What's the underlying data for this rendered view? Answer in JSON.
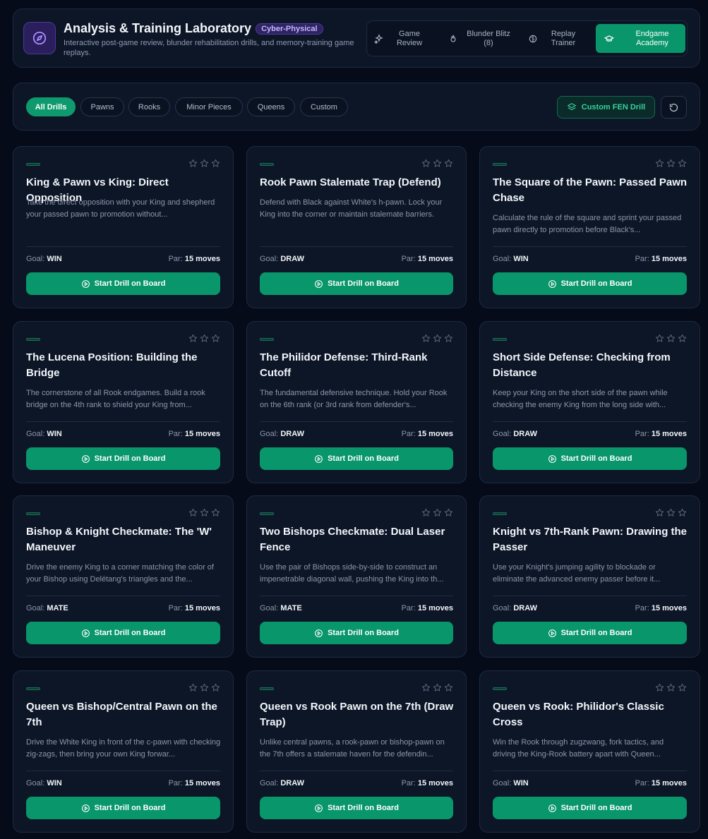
{
  "header": {
    "title": "Analysis & Training Laboratory",
    "badge": "Cyber-Physical",
    "subtitle": "Interactive post-game review, blunder rehabilitation drills, and memory-training game replays."
  },
  "modes": [
    {
      "label": "Game Review",
      "icon": "sparkles-icon",
      "active": false
    },
    {
      "label": "Blunder Blitz (8)",
      "icon": "flame-icon",
      "active": false
    },
    {
      "label": "Replay Trainer",
      "icon": "brain-icon",
      "active": false
    },
    {
      "label": "Endgame Academy",
      "icon": "graduation-cap-icon",
      "active": true
    }
  ],
  "filters": {
    "chips": [
      "All Drills",
      "Pawns",
      "Rooks",
      "Minor Pieces",
      "Queens",
      "Custom"
    ],
    "active": "All Drills",
    "custom_fen_label": "Custom FEN Drill",
    "custom_fen_icon": "layers-icon",
    "reset_icon": "reset-icon"
  },
  "labels": {
    "goal": "Goal:",
    "par": "Par:",
    "start": "Start Drill on Board"
  },
  "accent": "#08966a",
  "drills": [
    {
      "title": "King & Pawn vs King: Direct Opposition",
      "desc": "Take the direct opposition with your King and shepherd your passed pawn to promotion without...",
      "goal": "WIN",
      "par": "15 moves",
      "stars": 0
    },
    {
      "title": "Rook Pawn Stalemate Trap (Defend)",
      "desc": "Defend with Black against White's h-pawn. Lock your King into the corner or maintain stalemate barriers.",
      "goal": "DRAW",
      "par": "15 moves",
      "stars": 0
    },
    {
      "title": "The Square of the Pawn: Passed Pawn Chase",
      "desc": "Calculate the rule of the square and sprint your passed pawn directly to promotion before Black's...",
      "goal": "WIN",
      "par": "15 moves",
      "stars": 0
    },
    {
      "title": "The Lucena Position: Building the Bridge",
      "desc": "The cornerstone of all Rook endgames. Build a rook bridge on the 4th rank to shield your King from...",
      "goal": "WIN",
      "par": "15 moves",
      "stars": 0
    },
    {
      "title": "The Philidor Defense: Third-Rank Cutoff",
      "desc": "The fundamental defensive technique. Hold your Rook on the 6th rank (or 3rd rank from defender's...",
      "goal": "DRAW",
      "par": "15 moves",
      "stars": 0
    },
    {
      "title": "Short Side Defense: Checking from Distance",
      "desc": "Keep your King on the short side of the pawn while checking the enemy King from the long side with...",
      "goal": "DRAW",
      "par": "15 moves",
      "stars": 0
    },
    {
      "title": "Bishop & Knight Checkmate: The 'W' Maneuver",
      "desc": "Drive the enemy King to a corner matching the color of your Bishop using Delétang's triangles and the...",
      "goal": "MATE",
      "par": "15 moves",
      "stars": 0
    },
    {
      "title": "Two Bishops Checkmate: Dual Laser Fence",
      "desc": "Use the pair of Bishops side-by-side to construct an impenetrable diagonal wall, pushing the King into th...",
      "goal": "MATE",
      "par": "15 moves",
      "stars": 0
    },
    {
      "title": "Knight vs 7th-Rank Pawn: Drawing the Passer",
      "desc": "Use your Knight's jumping agility to blockade or eliminate the advanced enemy passer before it...",
      "goal": "DRAW",
      "par": "15 moves",
      "stars": 0
    },
    {
      "title": "Queen vs Bishop/Central Pawn on the 7th",
      "desc": "Drive the White King in front of the c-pawn with checking zig-zags, then bring your own King forwar...",
      "goal": "WIN",
      "par": "15 moves",
      "stars": 0
    },
    {
      "title": "Queen vs Rook Pawn on the 7th (Draw Trap)",
      "desc": "Unlike central pawns, a rook-pawn or bishop-pawn on the 7th offers a stalemate haven for the defendin...",
      "goal": "DRAW",
      "par": "15 moves",
      "stars": 0
    },
    {
      "title": "Queen vs Rook: Philidor's Classic Cross",
      "desc": "Win the Rook through zugzwang, fork tactics, and driving the King-Rook battery apart with Queen...",
      "goal": "WIN",
      "par": "15 moves",
      "stars": 0
    }
  ]
}
